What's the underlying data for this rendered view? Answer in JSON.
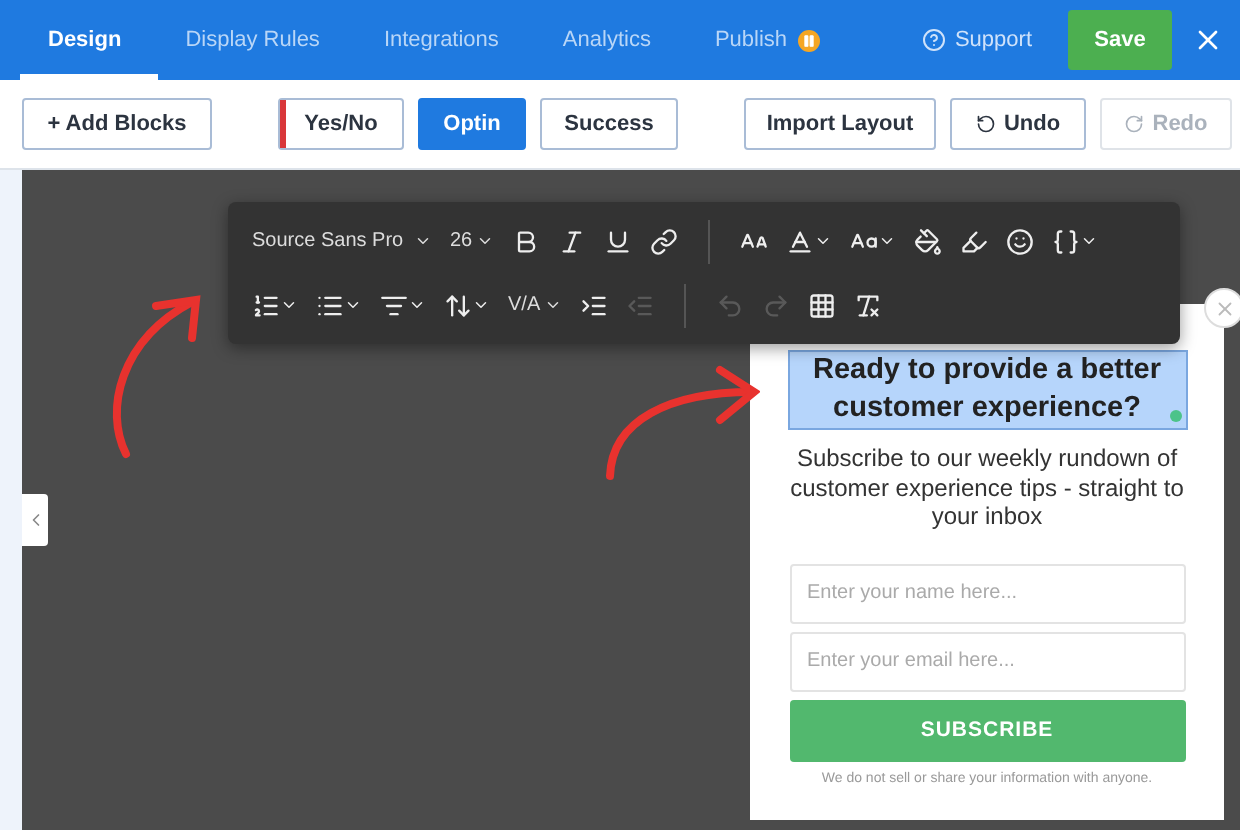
{
  "nav": {
    "tabs": [
      {
        "label": "Design",
        "selected": true
      },
      {
        "label": "Display Rules",
        "selected": false
      },
      {
        "label": "Integrations",
        "selected": false
      },
      {
        "label": "Analytics",
        "selected": false
      },
      {
        "label": "Publish",
        "selected": false,
        "paused": true
      }
    ],
    "support": "Support",
    "save": "Save"
  },
  "toolbar": {
    "add_blocks": "+ Add Blocks",
    "views": [
      {
        "label": "Yes/No",
        "selected": false
      },
      {
        "label": "Optin",
        "selected": true
      },
      {
        "label": "Success",
        "selected": false
      }
    ],
    "import_layout": "Import Layout",
    "undo": {
      "label": "Undo",
      "disabled": false
    },
    "redo": {
      "label": "Redo",
      "disabled": true
    }
  },
  "editor_toolbar": {
    "font": "Source Sans Pro",
    "size": "26",
    "spacing": "V/A",
    "row_1": [
      {
        "kind": "bold"
      },
      {
        "kind": "italic"
      },
      {
        "kind": "underline"
      },
      {
        "kind": "link"
      },
      {
        "kind": "divider"
      },
      {
        "kind": "font-size"
      },
      {
        "kind": "font-color"
      },
      {
        "kind": "case"
      },
      {
        "kind": "fill"
      },
      {
        "kind": "highlight"
      },
      {
        "kind": "emoji"
      },
      {
        "kind": "code"
      }
    ],
    "row_2": [
      {
        "kind": "ordered-list"
      },
      {
        "kind": "bullet-list"
      },
      {
        "kind": "align"
      },
      {
        "kind": "line-height"
      },
      {
        "kind": "spacing"
      },
      {
        "kind": "indent"
      },
      {
        "kind": "outdent",
        "disabled": true
      },
      {
        "kind": "divider"
      },
      {
        "kind": "undo",
        "disabled": true
      },
      {
        "kind": "redo",
        "disabled": true
      },
      {
        "kind": "select-all"
      },
      {
        "kind": "clear-format"
      }
    ]
  },
  "popup": {
    "headline": {
      "text": "Ready to provide a better customer experience?",
      "selected": true
    },
    "body": "Subscribe to our weekly rundown of customer experience tips - straight to your inbox",
    "fields": [
      {
        "placeholder": "Enter your name here..."
      },
      {
        "placeholder": "Enter your email here..."
      }
    ],
    "button": "SUBSCRIBE",
    "disclaimer": "We do not sell or share your information with anyone."
  }
}
